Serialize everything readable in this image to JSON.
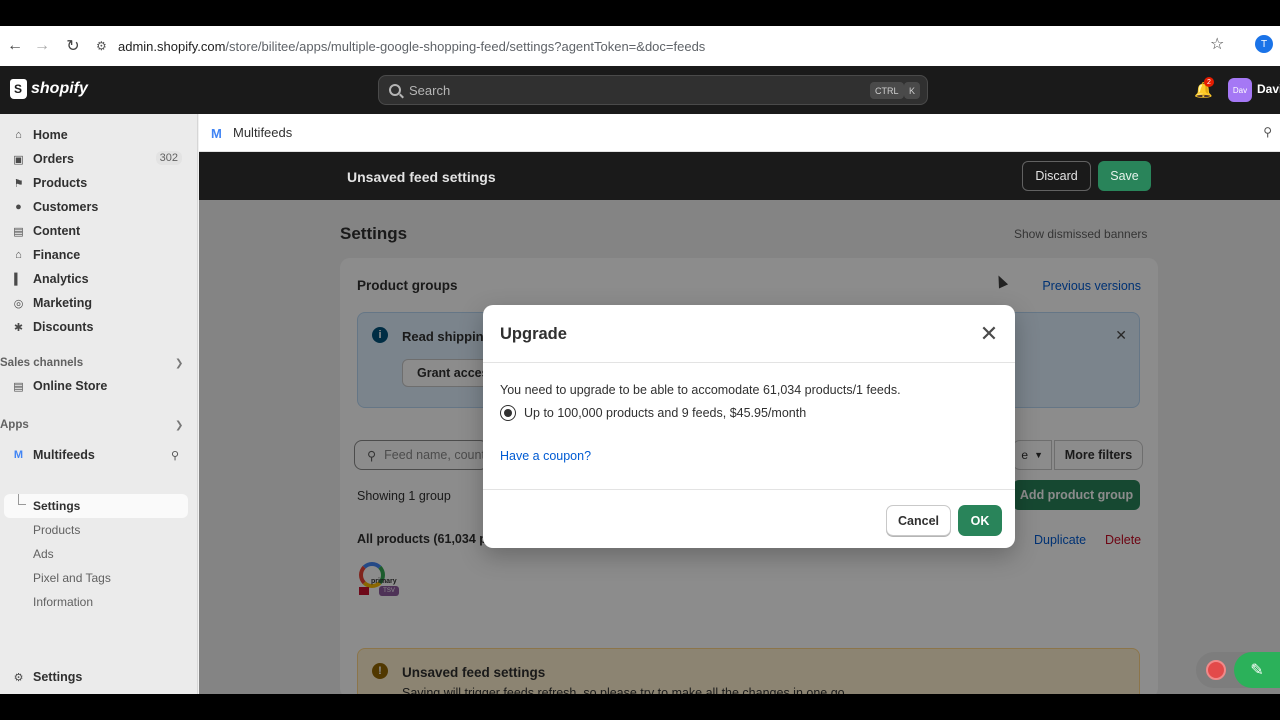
{
  "browser": {
    "url_host": "admin.shopify.com",
    "url_path": "/store/bilitee/apps/multiple-google-shopping-feed/settings?agentToken=&doc=feeds",
    "profile_initial": "T"
  },
  "header": {
    "logo_text": "shopify",
    "search_placeholder": "Search",
    "kbd_ctrl": "CTRL",
    "kbd_k": "K",
    "notification_count": "2",
    "avatar_initials": "Dav",
    "user_name": "Davi"
  },
  "sidebar": {
    "items": [
      {
        "label": "Home",
        "icon": "home-icon"
      },
      {
        "label": "Orders",
        "icon": "orders-icon",
        "count": "302"
      },
      {
        "label": "Products",
        "icon": "tag-icon"
      },
      {
        "label": "Customers",
        "icon": "person-icon"
      },
      {
        "label": "Content",
        "icon": "content-icon"
      },
      {
        "label": "Finance",
        "icon": "bank-icon"
      },
      {
        "label": "Analytics",
        "icon": "chart-icon"
      },
      {
        "label": "Marketing",
        "icon": "target-icon"
      },
      {
        "label": "Discounts",
        "icon": "discount-icon"
      }
    ],
    "sales_channels_title": "Sales channels",
    "online_store": "Online Store",
    "apps_title": "Apps",
    "app_name": "Multifeeds",
    "app_sub_items": [
      "Settings",
      "Products",
      "Ads",
      "Pixel and Tags",
      "Information"
    ],
    "settings_label": "Settings"
  },
  "app_bar": {
    "logo": "M",
    "title": "Multifeeds"
  },
  "save_bar": {
    "title": "Unsaved feed settings",
    "discard": "Discard",
    "save": "Save"
  },
  "page": {
    "title": "Settings",
    "show_dismissed": "Show dismissed banners",
    "card_title": "Product groups",
    "previous_versions": "Previous versions",
    "info_banner_text": "Read shippin",
    "grant_button": "Grant acces",
    "filter_placeholder": "Feed name, count",
    "filter_dropdown": "e",
    "more_filters": "More filters",
    "showing": "Showing 1 group",
    "add_group": "Add product group",
    "group_name": "All products (61,034 pr",
    "duplicate": "Duplicate",
    "delete": "Delete",
    "feed_label_primary": "primary",
    "feed_label_tsv": "TSV",
    "warn_title": "Unsaved feed settings",
    "warn_desc": "Saving will trigger feeds refresh, so please try to make all the changes in one go."
  },
  "modal": {
    "title": "Upgrade",
    "body": "You need to upgrade to be able to accomodate 61,034 products/1 feeds.",
    "option": "Up to 100,000 products and 9 feeds, $45.95/month",
    "option_selected": true,
    "coupon": "Have a coupon?",
    "cancel": "Cancel",
    "ok": "OK"
  }
}
